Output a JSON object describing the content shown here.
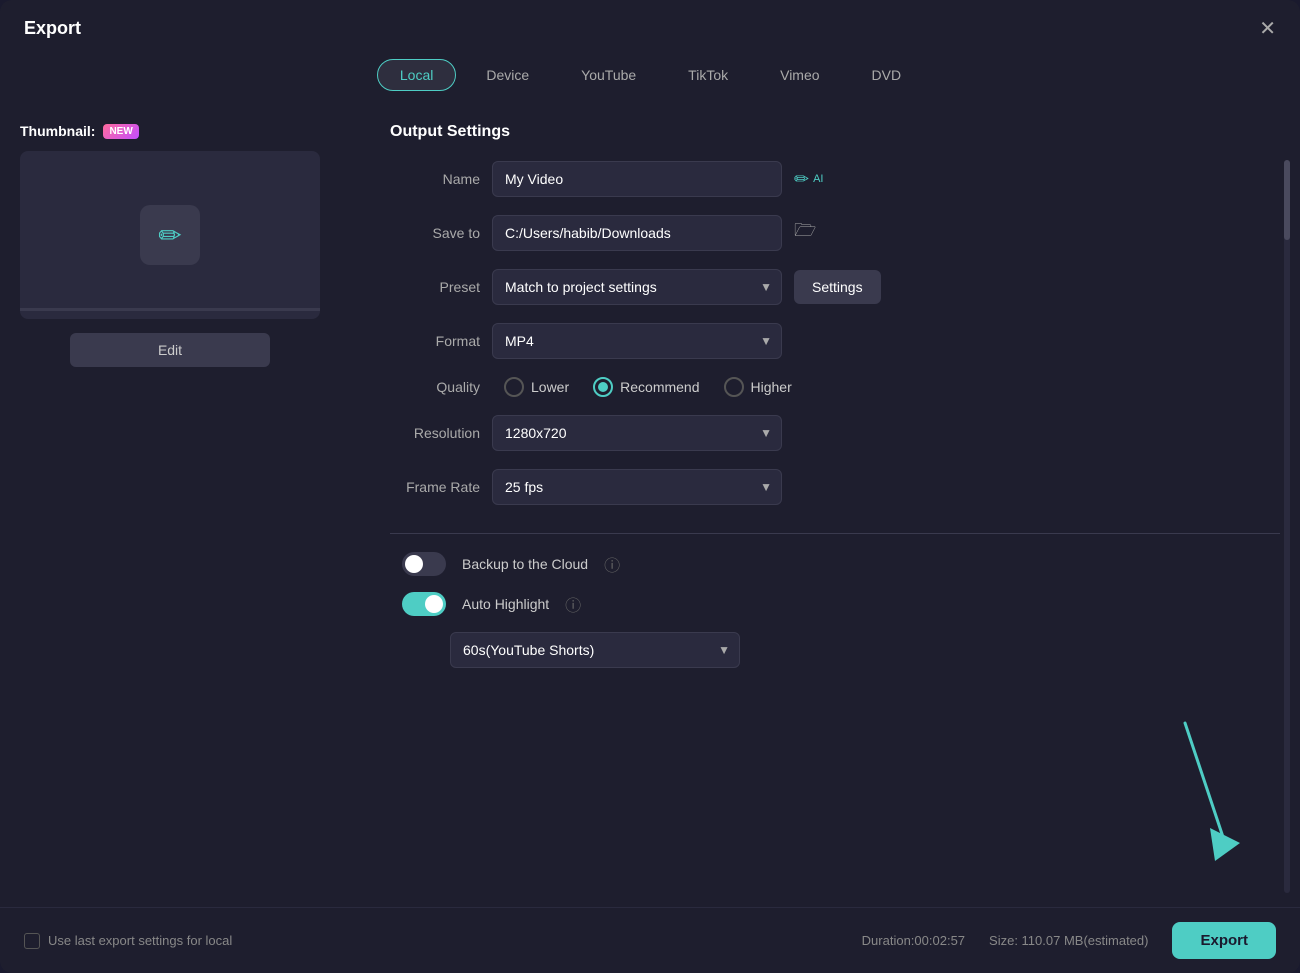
{
  "dialog": {
    "title": "Export",
    "close_label": "✕"
  },
  "tabs": [
    {
      "id": "local",
      "label": "Local",
      "active": true
    },
    {
      "id": "device",
      "label": "Device",
      "active": false
    },
    {
      "id": "youtube",
      "label": "YouTube",
      "active": false
    },
    {
      "id": "tiktok",
      "label": "TikTok",
      "active": false
    },
    {
      "id": "vimeo",
      "label": "Vimeo",
      "active": false
    },
    {
      "id": "dvd",
      "label": "DVD",
      "active": false
    }
  ],
  "thumbnail": {
    "label": "Thumbnail:",
    "new_badge": "NEW",
    "edit_button": "Edit"
  },
  "output_settings": {
    "section_title": "Output Settings",
    "name_label": "Name",
    "name_value": "My Video",
    "save_to_label": "Save to",
    "save_to_value": "C:/Users/habib/Downloads",
    "preset_label": "Preset",
    "preset_value": "Match to project settings",
    "settings_button": "Settings",
    "format_label": "Format",
    "format_value": "MP4",
    "quality_label": "Quality",
    "quality_options": [
      {
        "id": "lower",
        "label": "Lower",
        "checked": false
      },
      {
        "id": "recommend",
        "label": "Recommend",
        "checked": true
      },
      {
        "id": "higher",
        "label": "Higher",
        "checked": false
      }
    ],
    "resolution_label": "Resolution",
    "resolution_value": "1280x720",
    "frame_rate_label": "Frame Rate",
    "frame_rate_value": "25 fps",
    "backup_cloud_label": "Backup to the Cloud",
    "backup_cloud_on": false,
    "auto_highlight_label": "Auto Highlight",
    "auto_highlight_on": true,
    "highlight_option": "60s(YouTube Shorts)"
  },
  "footer": {
    "use_last_label": "Use last export settings for local",
    "duration_label": "Duration:00:02:57",
    "size_label": "Size: 110.07 MB(estimated)",
    "export_button": "Export"
  }
}
